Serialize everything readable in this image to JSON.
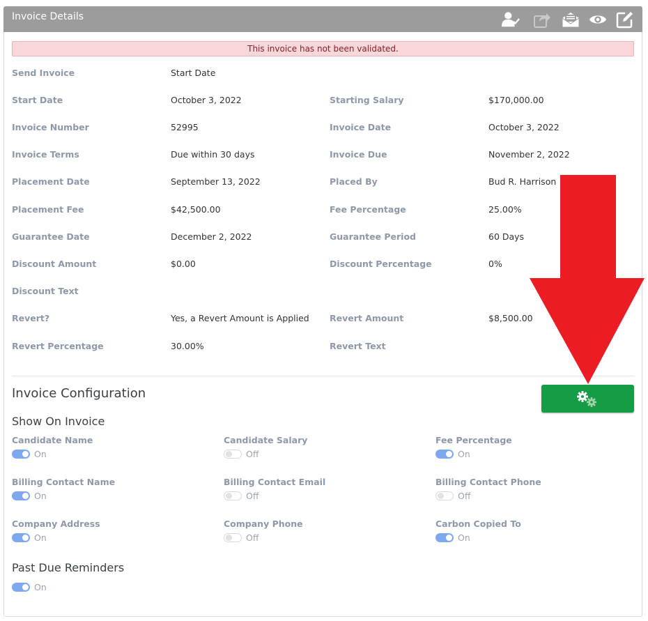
{
  "header": {
    "title": "Invoice Details"
  },
  "header_icons": [
    "user-check-icon",
    "share-icon",
    "email-open-icon",
    "eye-icon",
    "edit-icon"
  ],
  "alert": {
    "text": "This invoice has not been validated."
  },
  "details": {
    "send_invoice": {
      "label": "Send Invoice",
      "value": "Start Date"
    },
    "start_date": {
      "label": "Start Date",
      "value": "October 3, 2022"
    },
    "starting_salary": {
      "label": "Starting Salary",
      "value": "$170,000.00"
    },
    "invoice_number": {
      "label": "Invoice Number",
      "value": "52995"
    },
    "invoice_date": {
      "label": "Invoice Date",
      "value": "October 3, 2022"
    },
    "invoice_terms": {
      "label": "Invoice Terms",
      "value": "Due within 30 days"
    },
    "invoice_due": {
      "label": "Invoice Due",
      "value": "November 2, 2022"
    },
    "placement_date": {
      "label": "Placement Date",
      "value": "September 13, 2022"
    },
    "placed_by": {
      "label": "Placed By",
      "value": "Bud R. Harrison"
    },
    "placement_fee": {
      "label": "Placement Fee",
      "value": "$42,500.00"
    },
    "fee_percentage": {
      "label": "Fee Percentage",
      "value": "25.00%"
    },
    "guarantee_date": {
      "label": "Guarantee Date",
      "value": "December 2, 2022"
    },
    "guarantee_period": {
      "label": "Guarantee Period",
      "value": "60 Days"
    },
    "discount_amount": {
      "label": "Discount Amount",
      "value": "$0.00"
    },
    "discount_percentage": {
      "label": "Discount Percentage",
      "value": "0%"
    },
    "discount_text": {
      "label": "Discount Text",
      "value": ""
    },
    "revert": {
      "label": "Revert?",
      "value": "Yes, a Revert Amount is Applied"
    },
    "revert_amount": {
      "label": "Revert Amount",
      "value": "$8,500.00"
    },
    "revert_percentage": {
      "label": "Revert Percentage",
      "value": "30.00%"
    },
    "revert_text": {
      "label": "Revert Text",
      "value": ""
    }
  },
  "config": {
    "title": "Invoice Configuration",
    "button_icon": "gears-icon",
    "show_on_invoice_title": "Show On Invoice",
    "options": {
      "candidate_name": {
        "label": "Candidate Name",
        "state": "On"
      },
      "candidate_salary": {
        "label": "Candidate Salary",
        "state": "Off"
      },
      "fee_percentage": {
        "label": "Fee Percentage",
        "state": "On"
      },
      "billing_contact_name": {
        "label": "Billing Contact Name",
        "state": "On"
      },
      "billing_contact_email": {
        "label": "Billing Contact Email",
        "state": "Off"
      },
      "billing_contact_phone": {
        "label": "Billing Contact Phone",
        "state": "Off"
      },
      "company_address": {
        "label": "Company Address",
        "state": "On"
      },
      "company_phone": {
        "label": "Company Phone",
        "state": "Off"
      },
      "carbon_copied_to": {
        "label": "Carbon Copied To",
        "state": "On"
      }
    },
    "past_due_title": "Past Due Reminders",
    "past_due_state": "On"
  },
  "colors": {
    "header": "#9c9c9c",
    "button": "#169b46",
    "toggle_on": "#80a8f0",
    "arrow": "#ec1c24",
    "alert_bg": "#f8d7da"
  }
}
